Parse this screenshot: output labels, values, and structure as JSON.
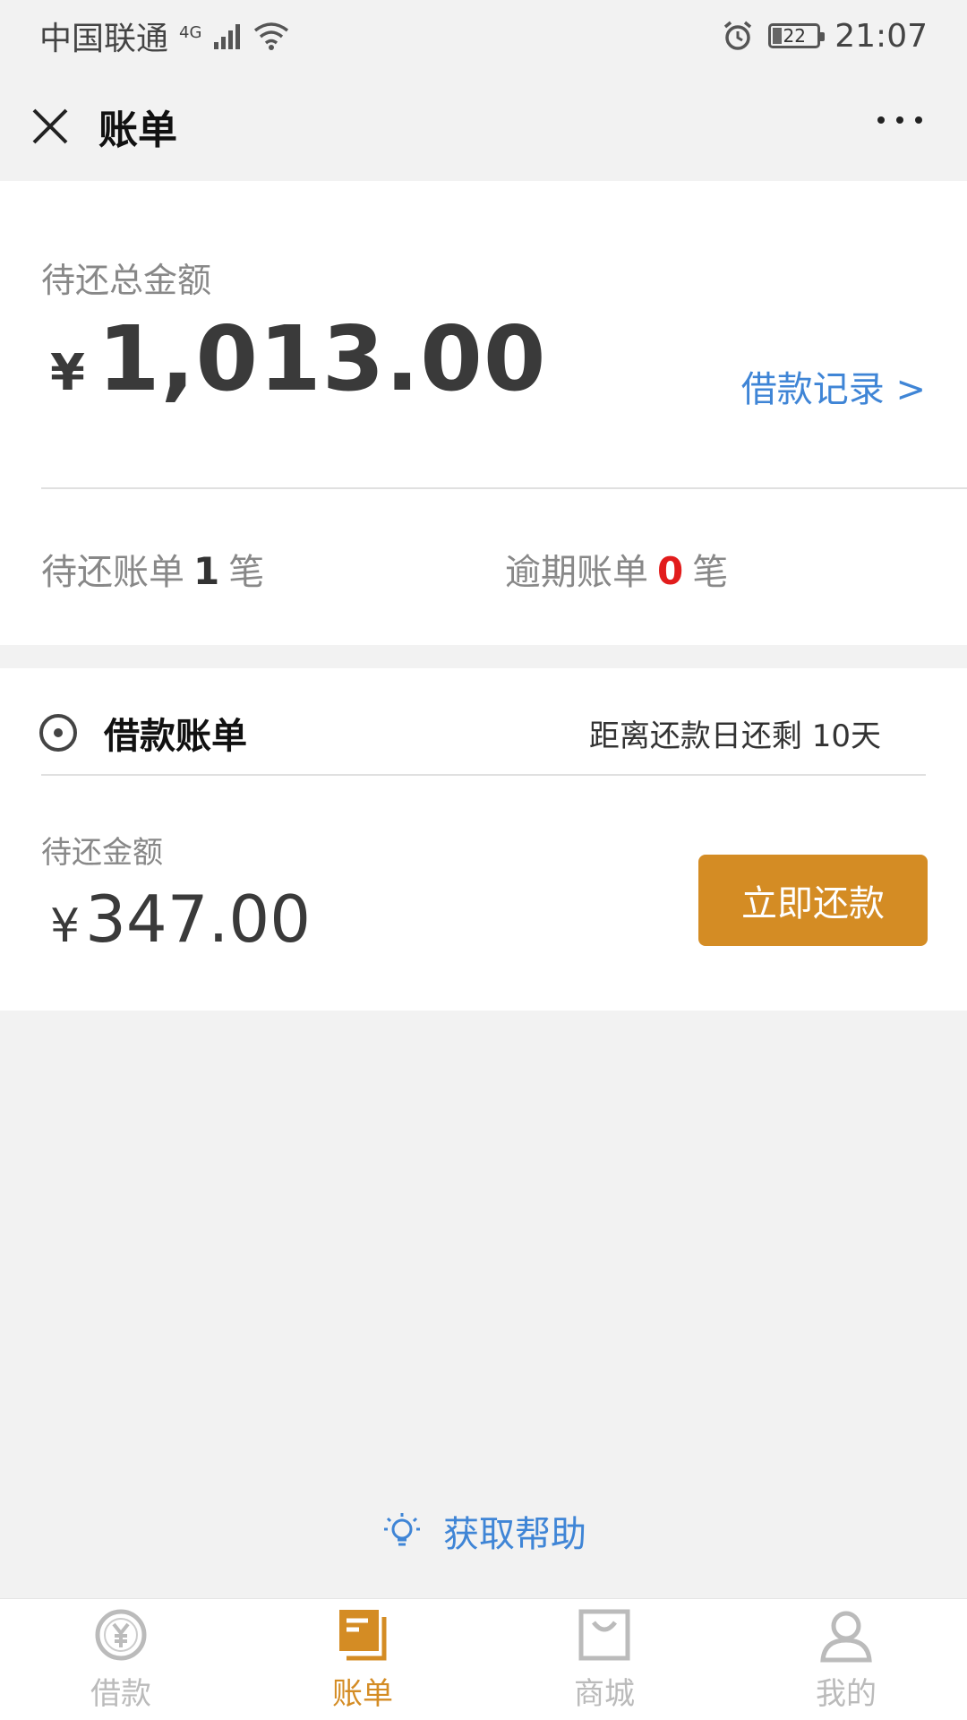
{
  "status_bar": {
    "carrier": "中国联通",
    "network": "4G",
    "battery": "22",
    "time": "21:07"
  },
  "nav": {
    "title": "账单"
  },
  "summary": {
    "total_label": "待还总金额",
    "currency": "¥",
    "total_amount": "1,013.00",
    "loan_record_link": "借款记录 >",
    "pending_prefix": "待还账单",
    "pending_count": "1",
    "pending_suffix": "笔",
    "overdue_prefix": "逾期账单",
    "overdue_count": "0",
    "overdue_suffix": "笔"
  },
  "bill": {
    "title": "借款账单",
    "due_text": "距离还款日还剩 10天",
    "amount_label": "待还金额",
    "currency": "¥",
    "amount": "347.00",
    "repay_button": "立即还款"
  },
  "help": {
    "label": "获取帮助"
  },
  "tabs": [
    {
      "label": "借款",
      "icon": "loan-icon",
      "active": false
    },
    {
      "label": "账单",
      "icon": "bill-icon",
      "active": true
    },
    {
      "label": "商城",
      "icon": "mall-icon",
      "active": false
    },
    {
      "label": "我的",
      "icon": "profile-icon",
      "active": false
    }
  ],
  "colors": {
    "accent": "#d48c24",
    "link": "#3f85d6",
    "overdue": "#e21c1c"
  }
}
